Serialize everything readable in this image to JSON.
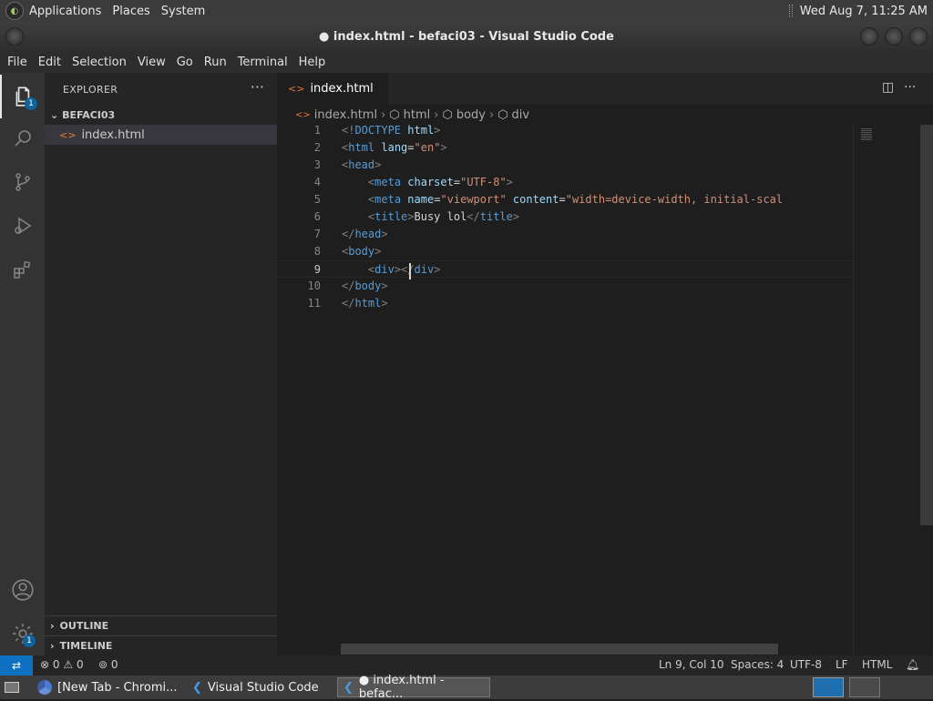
{
  "top_panel": {
    "menus": [
      "Applications",
      "Places",
      "System"
    ],
    "datetime": "Wed Aug  7, 11:25 AM"
  },
  "window": {
    "title": "● index.html - befaci03 - Visual Studio Code"
  },
  "menubar": [
    "File",
    "Edit",
    "Selection",
    "View",
    "Go",
    "Run",
    "Terminal",
    "Help"
  ],
  "activity": {
    "explorer_badge": "1",
    "settings_badge": "1"
  },
  "sidebar": {
    "title": "EXPLORER",
    "more": "···",
    "folder": "BEFACI03",
    "file": "index.html",
    "outline": "OUTLINE",
    "timeline": "TIMELINE"
  },
  "tab": {
    "label": "index.html"
  },
  "breadcrumb": [
    "index.html",
    "html",
    "body",
    "div"
  ],
  "code_lines": [
    {
      "num": "1",
      "parts": [
        [
          "x",
          "<!"
        ],
        [
          "t",
          "DOCTYPE"
        ],
        [
          "txt",
          " "
        ],
        [
          "a",
          "html"
        ],
        [
          "x",
          ">"
        ]
      ]
    },
    {
      "num": "2",
      "parts": [
        [
          "x",
          "<"
        ],
        [
          "t",
          "html"
        ],
        [
          "txt",
          " "
        ],
        [
          "a",
          "lang"
        ],
        [
          "txt",
          "="
        ],
        [
          "s",
          "\"en\""
        ],
        [
          "x",
          ">"
        ]
      ]
    },
    {
      "num": "3",
      "parts": [
        [
          "x",
          "<"
        ],
        [
          "t",
          "head"
        ],
        [
          "x",
          ">"
        ]
      ]
    },
    {
      "num": "4",
      "parts": [
        [
          "txt",
          "    "
        ],
        [
          "x",
          "<"
        ],
        [
          "t",
          "meta"
        ],
        [
          "txt",
          " "
        ],
        [
          "a",
          "charset"
        ],
        [
          "txt",
          "="
        ],
        [
          "s",
          "\"UTF-8\""
        ],
        [
          "x",
          ">"
        ]
      ]
    },
    {
      "num": "5",
      "parts": [
        [
          "txt",
          "    "
        ],
        [
          "x",
          "<"
        ],
        [
          "t",
          "meta"
        ],
        [
          "txt",
          " "
        ],
        [
          "a",
          "name"
        ],
        [
          "txt",
          "="
        ],
        [
          "s",
          "\"viewport\""
        ],
        [
          "txt",
          " "
        ],
        [
          "a",
          "content"
        ],
        [
          "txt",
          "="
        ],
        [
          "s",
          "\"width=device-width, initial-scal"
        ]
      ]
    },
    {
      "num": "6",
      "parts": [
        [
          "txt",
          "    "
        ],
        [
          "x",
          "<"
        ],
        [
          "t",
          "title"
        ],
        [
          "x",
          ">"
        ],
        [
          "txt",
          "Busy lol"
        ],
        [
          "x",
          "</"
        ],
        [
          "t",
          "title"
        ],
        [
          "x",
          ">"
        ]
      ]
    },
    {
      "num": "7",
      "parts": [
        [
          "x",
          "</"
        ],
        [
          "t",
          "head"
        ],
        [
          "x",
          ">"
        ]
      ]
    },
    {
      "num": "8",
      "parts": [
        [
          "x",
          "<"
        ],
        [
          "t",
          "body"
        ],
        [
          "x",
          ">"
        ]
      ]
    },
    {
      "num": "9",
      "parts": [
        [
          "txt",
          "    "
        ],
        [
          "x",
          "<"
        ],
        [
          "t",
          "div"
        ],
        [
          "x",
          "></"
        ],
        [
          "t",
          "div"
        ],
        [
          "x",
          ">"
        ]
      ]
    },
    {
      "num": "10",
      "parts": [
        [
          "x",
          "</"
        ],
        [
          "t",
          "body"
        ],
        [
          "x",
          ">"
        ]
      ]
    },
    {
      "num": "11",
      "parts": [
        [
          "x",
          "</"
        ],
        [
          "t",
          "html"
        ],
        [
          "x",
          ">"
        ]
      ]
    }
  ],
  "status": {
    "errors": "0",
    "warnings": "0",
    "ports": "0",
    "position": "Ln 9, Col 10",
    "spaces": "Spaces: 4",
    "encoding": "UTF-8",
    "eol": "LF",
    "language": "HTML"
  },
  "taskbar": {
    "items": [
      "[New Tab - Chromi...",
      "Visual Studio Code",
      "● index.html - befac..."
    ]
  }
}
